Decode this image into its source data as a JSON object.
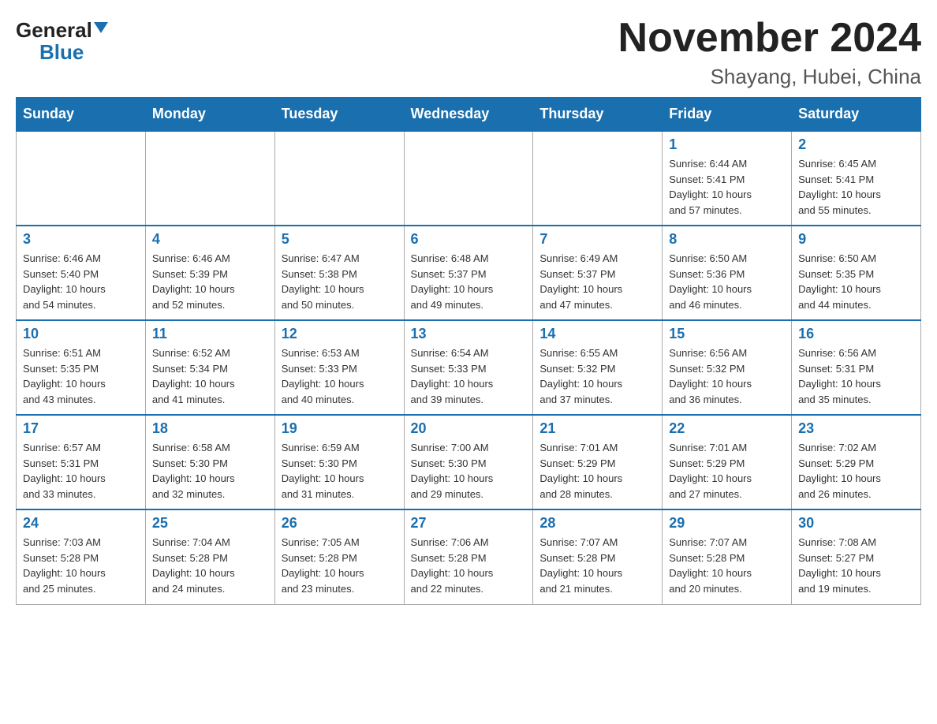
{
  "logo": {
    "general": "General",
    "blue": "Blue"
  },
  "header": {
    "month": "November 2024",
    "location": "Shayang, Hubei, China"
  },
  "weekdays": [
    "Sunday",
    "Monday",
    "Tuesday",
    "Wednesday",
    "Thursday",
    "Friday",
    "Saturday"
  ],
  "weeks": [
    [
      {
        "day": "",
        "info": ""
      },
      {
        "day": "",
        "info": ""
      },
      {
        "day": "",
        "info": ""
      },
      {
        "day": "",
        "info": ""
      },
      {
        "day": "",
        "info": ""
      },
      {
        "day": "1",
        "info": "Sunrise: 6:44 AM\nSunset: 5:41 PM\nDaylight: 10 hours\nand 57 minutes."
      },
      {
        "day": "2",
        "info": "Sunrise: 6:45 AM\nSunset: 5:41 PM\nDaylight: 10 hours\nand 55 minutes."
      }
    ],
    [
      {
        "day": "3",
        "info": "Sunrise: 6:46 AM\nSunset: 5:40 PM\nDaylight: 10 hours\nand 54 minutes."
      },
      {
        "day": "4",
        "info": "Sunrise: 6:46 AM\nSunset: 5:39 PM\nDaylight: 10 hours\nand 52 minutes."
      },
      {
        "day": "5",
        "info": "Sunrise: 6:47 AM\nSunset: 5:38 PM\nDaylight: 10 hours\nand 50 minutes."
      },
      {
        "day": "6",
        "info": "Sunrise: 6:48 AM\nSunset: 5:37 PM\nDaylight: 10 hours\nand 49 minutes."
      },
      {
        "day": "7",
        "info": "Sunrise: 6:49 AM\nSunset: 5:37 PM\nDaylight: 10 hours\nand 47 minutes."
      },
      {
        "day": "8",
        "info": "Sunrise: 6:50 AM\nSunset: 5:36 PM\nDaylight: 10 hours\nand 46 minutes."
      },
      {
        "day": "9",
        "info": "Sunrise: 6:50 AM\nSunset: 5:35 PM\nDaylight: 10 hours\nand 44 minutes."
      }
    ],
    [
      {
        "day": "10",
        "info": "Sunrise: 6:51 AM\nSunset: 5:35 PM\nDaylight: 10 hours\nand 43 minutes."
      },
      {
        "day": "11",
        "info": "Sunrise: 6:52 AM\nSunset: 5:34 PM\nDaylight: 10 hours\nand 41 minutes."
      },
      {
        "day": "12",
        "info": "Sunrise: 6:53 AM\nSunset: 5:33 PM\nDaylight: 10 hours\nand 40 minutes."
      },
      {
        "day": "13",
        "info": "Sunrise: 6:54 AM\nSunset: 5:33 PM\nDaylight: 10 hours\nand 39 minutes."
      },
      {
        "day": "14",
        "info": "Sunrise: 6:55 AM\nSunset: 5:32 PM\nDaylight: 10 hours\nand 37 minutes."
      },
      {
        "day": "15",
        "info": "Sunrise: 6:56 AM\nSunset: 5:32 PM\nDaylight: 10 hours\nand 36 minutes."
      },
      {
        "day": "16",
        "info": "Sunrise: 6:56 AM\nSunset: 5:31 PM\nDaylight: 10 hours\nand 35 minutes."
      }
    ],
    [
      {
        "day": "17",
        "info": "Sunrise: 6:57 AM\nSunset: 5:31 PM\nDaylight: 10 hours\nand 33 minutes."
      },
      {
        "day": "18",
        "info": "Sunrise: 6:58 AM\nSunset: 5:30 PM\nDaylight: 10 hours\nand 32 minutes."
      },
      {
        "day": "19",
        "info": "Sunrise: 6:59 AM\nSunset: 5:30 PM\nDaylight: 10 hours\nand 31 minutes."
      },
      {
        "day": "20",
        "info": "Sunrise: 7:00 AM\nSunset: 5:30 PM\nDaylight: 10 hours\nand 29 minutes."
      },
      {
        "day": "21",
        "info": "Sunrise: 7:01 AM\nSunset: 5:29 PM\nDaylight: 10 hours\nand 28 minutes."
      },
      {
        "day": "22",
        "info": "Sunrise: 7:01 AM\nSunset: 5:29 PM\nDaylight: 10 hours\nand 27 minutes."
      },
      {
        "day": "23",
        "info": "Sunrise: 7:02 AM\nSunset: 5:29 PM\nDaylight: 10 hours\nand 26 minutes."
      }
    ],
    [
      {
        "day": "24",
        "info": "Sunrise: 7:03 AM\nSunset: 5:28 PM\nDaylight: 10 hours\nand 25 minutes."
      },
      {
        "day": "25",
        "info": "Sunrise: 7:04 AM\nSunset: 5:28 PM\nDaylight: 10 hours\nand 24 minutes."
      },
      {
        "day": "26",
        "info": "Sunrise: 7:05 AM\nSunset: 5:28 PM\nDaylight: 10 hours\nand 23 minutes."
      },
      {
        "day": "27",
        "info": "Sunrise: 7:06 AM\nSunset: 5:28 PM\nDaylight: 10 hours\nand 22 minutes."
      },
      {
        "day": "28",
        "info": "Sunrise: 7:07 AM\nSunset: 5:28 PM\nDaylight: 10 hours\nand 21 minutes."
      },
      {
        "day": "29",
        "info": "Sunrise: 7:07 AM\nSunset: 5:28 PM\nDaylight: 10 hours\nand 20 minutes."
      },
      {
        "day": "30",
        "info": "Sunrise: 7:08 AM\nSunset: 5:27 PM\nDaylight: 10 hours\nand 19 minutes."
      }
    ]
  ]
}
